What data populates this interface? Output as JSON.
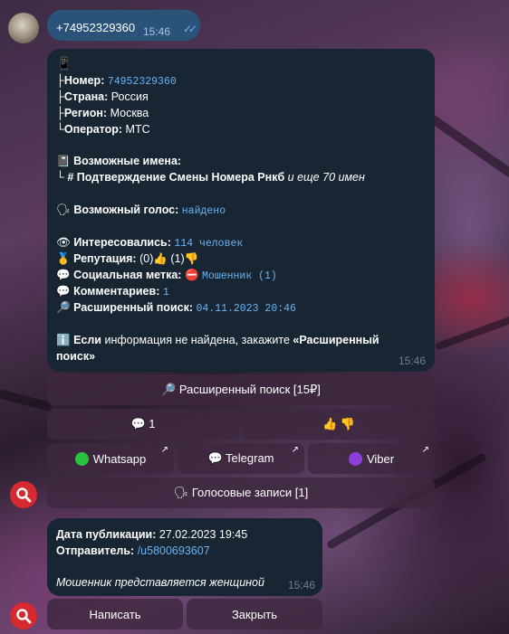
{
  "outgoing": {
    "text": "+74952329360",
    "time": "15:46"
  },
  "report": {
    "header_icon": "📱",
    "phone_label": "├Номер:",
    "phone_value": "74952329360",
    "country_label": "├Страна:",
    "country_value": "Россия",
    "region_label": "├Регион:",
    "region_value": "Москва",
    "operator_label": "└Оператор:",
    "operator_value": "МТС",
    "names_icon": "📓",
    "names_label": "Возможные имена:",
    "names_prefix": "└",
    "names_value": "# Подтверждение Смены Номера Рнкб",
    "names_more": "и еще 70 имен",
    "voice_icon": "🗣",
    "voice_label": "Возможный голос:",
    "voice_value": "найдено",
    "interested_icon": "👁",
    "interested_label": "Интересовались:",
    "interested_value": "114 человек",
    "reputation_icon": "🥇",
    "reputation_label": "Репутация:",
    "rep_up": "(0)",
    "rep_down": "(1)",
    "social_icon": "💬",
    "social_label": "Социальная метка:",
    "social_value": "Мошенник (1)",
    "comments_icon": "💬",
    "comments_label": "Комментариев:",
    "comments_value": "1",
    "extended_icon": "🔎",
    "extended_label": "Расширенный поиск:",
    "extended_value": "04.11.2023 20:46",
    "info_icon": "ℹ️",
    "info_bold": "Если",
    "info_text": " информация не найдена, закажите ",
    "info_quote_1": "«Расширенный",
    "info_quote_2": "поиск»",
    "time": "15:46"
  },
  "keyboard1": {
    "extended_search": "🔎 Расширенный поиск [15₽]",
    "comments": "💬 1",
    "reactions": "👍 👎",
    "whatsapp": "Whatsapp",
    "telegram": "💬 Telegram",
    "viber": "Viber",
    "voice_records": "🗣 Голосовые записи [1]",
    "arrow": "↗"
  },
  "comment": {
    "date_label": "Дата публикации:",
    "date_value": "27.02.2023 19:45",
    "sender_label": "Отправитель:",
    "sender_value": "/u5800693607",
    "text": "Мошенник представляется женщиной",
    "time": "15:46"
  },
  "keyboard2": {
    "write": "Написать",
    "close": "Закрыть"
  },
  "colors": {
    "bubble": "#182533",
    "outgoing": "#2b5278",
    "link": "#6ab3f3",
    "fab": "#d62a30",
    "whatsapp_dot": "#29c23d",
    "viber_dot": "#8b3fd9"
  }
}
